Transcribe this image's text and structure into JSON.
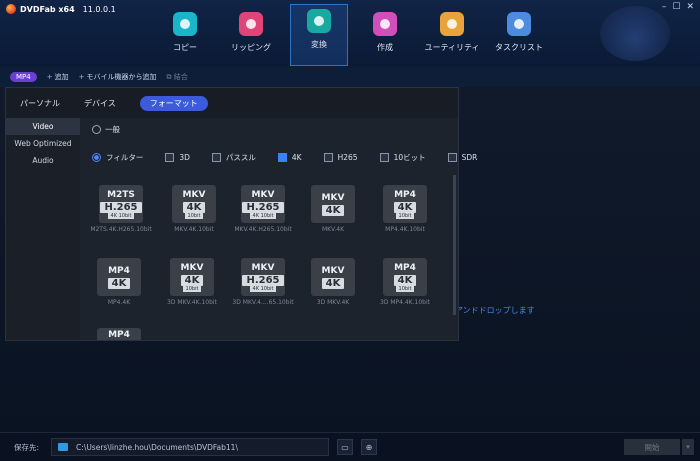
{
  "app": {
    "title": "DVDFab x64",
    "version": "11.0.0.1"
  },
  "nav": [
    {
      "label": "コピー",
      "color": "#19b5c8"
    },
    {
      "label": "リッピング",
      "color": "#e0457a"
    },
    {
      "label": "変換",
      "color": "#1aa9a0"
    },
    {
      "label": "作成",
      "color": "#d04fb8"
    },
    {
      "label": "ユーティリティ",
      "color": "#e8a33a"
    },
    {
      "label": "タスクリスト",
      "color": "#4b8be0"
    }
  ],
  "toolbar": {
    "profile": "MP4",
    "add": "追加",
    "add_mobile": "モバイル機器から追加",
    "merge": "結合"
  },
  "panel": {
    "tabs": [
      "パーソナル",
      "デバイス",
      "フォーマット"
    ],
    "categories": [
      "Video",
      "Web Optimized",
      "Audio"
    ],
    "radio_all": "一般",
    "radio_filter": "フィルター",
    "filters": [
      {
        "label": "3D",
        "checked": false
      },
      {
        "label": "パススル",
        "checked": false
      },
      {
        "label": "4K",
        "checked": true
      },
      {
        "label": "H265",
        "checked": false
      },
      {
        "label": "10ビット",
        "checked": false
      },
      {
        "label": "SDR",
        "checked": false
      }
    ],
    "formats": [
      {
        "fmt": "M2TS",
        "q": "H.265",
        "sub": "4K 10bit",
        "cap": "M2TS.4K.H265.10bit"
      },
      {
        "fmt": "MKV",
        "q": "4K",
        "sub": "10bit",
        "cap": "MKV.4K.10bit"
      },
      {
        "fmt": "MKV",
        "q": "H.265",
        "sub": "4K 10bit",
        "cap": "MKV.4K.H265.10bit"
      },
      {
        "fmt": "MKV",
        "q": "4K",
        "sub": "",
        "cap": "MKV.4K"
      },
      {
        "fmt": "MP4",
        "q": "4K",
        "sub": "10bit",
        "cap": "MP4.4K.10bit"
      },
      {
        "fmt": "MP4",
        "q": "4K",
        "sub": "",
        "cap": "MP4.4K"
      },
      {
        "fmt": "MKV",
        "q": "4K",
        "sub": "10bit",
        "cap": "3D MKV.4K.10bit"
      },
      {
        "fmt": "MKV",
        "q": "H.265",
        "sub": "4K 10bit",
        "cap": "3D MKV.4....65.10bit"
      },
      {
        "fmt": "MKV",
        "q": "4K",
        "sub": "",
        "cap": "3D MKV.4K"
      },
      {
        "fmt": "MP4",
        "q": "4K",
        "sub": "10bit",
        "cap": "3D MP4.4K.10bit"
      },
      {
        "fmt": "MP4",
        "q": "",
        "sub": "",
        "cap": ""
      }
    ]
  },
  "drop_hint": "アンドドロップします",
  "footer": {
    "label": "保存先:",
    "path": "C:\\Users\\linzhe.hou\\Documents\\DVDFab11\\",
    "start": "開始"
  }
}
